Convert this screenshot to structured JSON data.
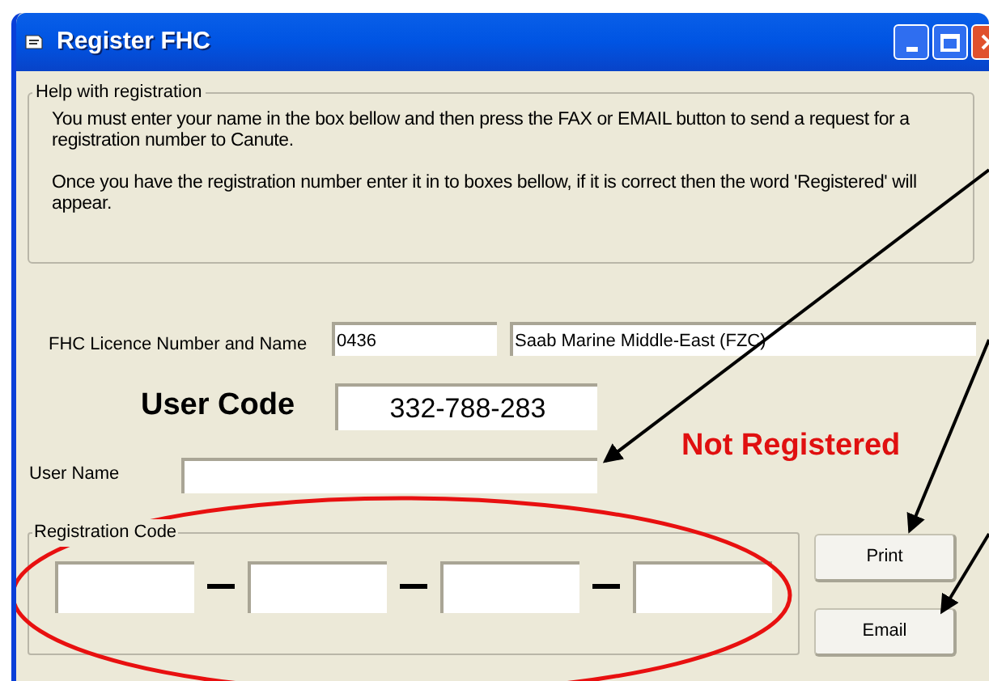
{
  "window": {
    "title": "Register FHC"
  },
  "help": {
    "title": "Help with registration",
    "paragraphs": [
      "You must enter your name in the box bellow and then press the FAX or EMAIL button to send a request for a registration number to Canute.",
      "Once you have the registration number enter it in to boxes bellow, if it is correct then the word 'Registered' will appear."
    ]
  },
  "licence": {
    "label": "FHC Licence Number and Name",
    "number": "0436",
    "name": "Saab Marine Middle-East (FZC)"
  },
  "user_code": {
    "label": "User Code",
    "value": "332-788-283"
  },
  "status": {
    "text": "Not Registered",
    "registered": false
  },
  "user_name": {
    "label": "User Name"
  },
  "registration_code": {
    "title": "Registration Code",
    "fields": [
      {
        "kind": "text"
      },
      {
        "kind": "text"
      },
      {
        "kind": "text"
      },
      {
        "kind": "text"
      }
    ]
  },
  "buttons": [
    "Print",
    "Email"
  ]
}
